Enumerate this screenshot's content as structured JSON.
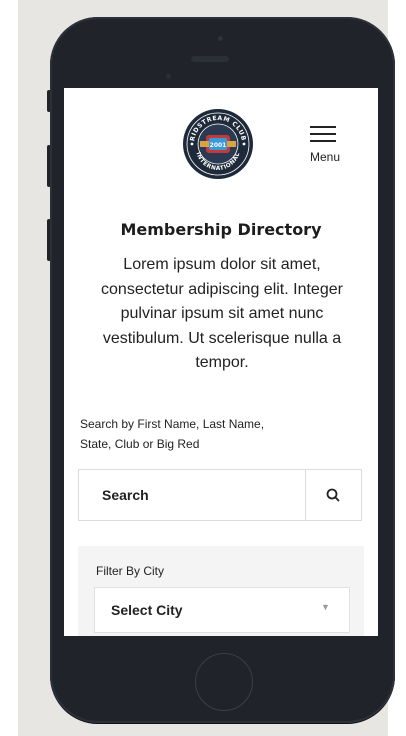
{
  "header": {
    "logo": {
      "top_text": "RIDSTREAM CLUB",
      "bottom_text": "INTERNATIONAL",
      "year": "2001"
    },
    "menu_label": "Menu"
  },
  "main": {
    "title": "Membership Directory",
    "intro": "Lorem ipsum dolor sit amet, consectetur adipiscing elit. Integer pulvinar ipsum sit amet nunc vestibulum. Ut scelerisque nulla a tempor."
  },
  "search": {
    "label": "Search by First Name, Last Name, State, Club or Big Red",
    "placeholder": "Search",
    "button_icon": "search-icon"
  },
  "filter": {
    "label": "Filter By City",
    "select_value": "Select City",
    "caret_icon": "chevron-down-icon"
  },
  "colors": {
    "phone_body": "#20232a",
    "logo_navy": "#1e2a3a",
    "logo_red": "#c23a3a",
    "logo_gold": "#d9a441",
    "logo_blue": "#3a9ad9"
  }
}
